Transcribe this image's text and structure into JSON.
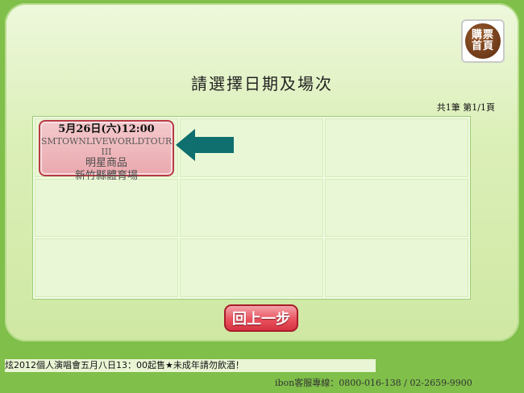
{
  "header": {
    "home_button_label": "購票首頁",
    "title": "請選擇日期及場次",
    "page_indicator": "共1筆  第1/1頁"
  },
  "event": {
    "date_time": "5月26日(六)12:00",
    "name": "SMTOWNLIVEWORLDTOUR III",
    "category": "明星商品",
    "venue": "新竹縣體育場"
  },
  "actions": {
    "back_label": "回上一步"
  },
  "footer": {
    "ticker": "炫2012個人演唱會五月八日13：00起售★未成年請勿飲酒！",
    "hotline": "ibon客服專線：0800-016-138 / 02-2659-9900"
  },
  "colors": {
    "background": "#7fbf4a",
    "event_border": "#b83a45",
    "arrow": "#0f6f6f",
    "back_button": "#d63340"
  }
}
